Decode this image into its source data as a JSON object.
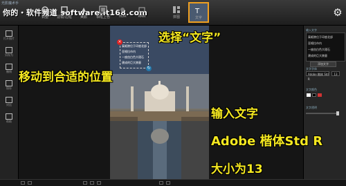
{
  "app": {
    "title": "光影魔术手"
  },
  "watermark": {
    "text": "你的・软件频道 software.it168.com"
  },
  "toolbar": {
    "tools": [
      {
        "label": "调整",
        "icon": "adjust-icon"
      },
      {
        "label": "滤镜/边框",
        "icon": "filter-icon"
      },
      {
        "label": "美颜",
        "icon": "beauty-icon"
      },
      {
        "label": "相框上色",
        "icon": "frame-icon"
      },
      {
        "label": "HDR",
        "icon": "hdr-icon"
      },
      {
        "label": "RAW",
        "icon": "raw-icon"
      },
      {
        "label": "拼图",
        "icon": "collage-icon"
      },
      {
        "label": "文字",
        "icon": "text-icon"
      }
    ],
    "selected_tool": "文字"
  },
  "left_bar": {
    "items": [
      {
        "label": "打开图片",
        "icon": "open-icon"
      },
      {
        "label": "另存为",
        "icon": "save-as-icon"
      },
      {
        "label": "撤销",
        "icon": "undo-icon"
      },
      {
        "label": "保存",
        "icon": "save-icon"
      },
      {
        "label": "对比",
        "icon": "compare-icon"
      },
      {
        "label": "帮助",
        "icon": "help-icon"
      }
    ]
  },
  "text_box": {
    "lines": [
      "泰姬陵位于印度北部",
      "亚格拉市内",
      "一座由白色大理石",
      "建成的巨大陵墓"
    ]
  },
  "right_panel": {
    "section_text_label": "输入文字",
    "text_lines": [
      "泰姬陵位于印度北部",
      "亚格拉市内",
      "一座由白色大理石",
      "建成的巨大陵墓"
    ],
    "add_button": "添加文字",
    "font_section_label": "文字字体",
    "font_name": "Adobe 楷体 Std R",
    "font_size": "13",
    "color_section_label": "文字颜色",
    "swatch_colors": [
      "#ffffff",
      "#000000",
      "#d33333"
    ],
    "transparency_label": "文字透明"
  },
  "annotations": {
    "select_text": "选择“文字”",
    "move_position": "移动到合适的位置",
    "input_text": "输入文字",
    "font_name": "Adobe 楷体Std R",
    "font_size": "大小为13"
  },
  "colors": {
    "annotation": "#f5e820",
    "selected_border": "#f0a020"
  }
}
